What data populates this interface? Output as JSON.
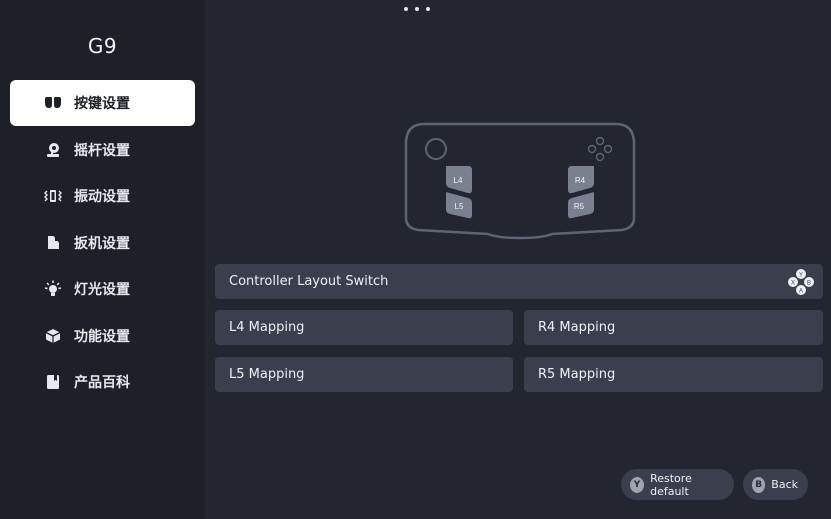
{
  "sidebar": {
    "brand": "G9",
    "items": [
      {
        "label": "按键设置",
        "icon": "buttons-icon",
        "active": true
      },
      {
        "label": "摇杆设置",
        "icon": "joystick-icon",
        "active": false
      },
      {
        "label": "振动设置",
        "icon": "vibration-icon",
        "active": false
      },
      {
        "label": "扳机设置",
        "icon": "trigger-icon",
        "active": false
      },
      {
        "label": "灯光设置",
        "icon": "light-icon",
        "active": false
      },
      {
        "label": "功能设置",
        "icon": "function-cube-icon",
        "active": false
      },
      {
        "label": "产品百科",
        "icon": "book-icon",
        "active": false
      }
    ]
  },
  "controller": {
    "l4": "L4",
    "l5": "L5",
    "r4": "R4",
    "r5": "R5"
  },
  "cards": {
    "layout_switch": "Controller Layout Switch",
    "l4_mapping": "L4 Mapping",
    "r4_mapping": "R4 Mapping",
    "l5_mapping": "L5 Mapping",
    "r5_mapping": "R5 Mapping"
  },
  "abxy": {
    "y": "Y",
    "x": "X",
    "b": "B",
    "a": "A"
  },
  "footer": {
    "restore_key": "Y",
    "restore_label": "Restore default",
    "back_key": "B",
    "back_label": "Back"
  },
  "colors": {
    "sidebar_bg": "#1e2027",
    "main_bg": "#23262f",
    "card_bg": "#3b3f4d",
    "active_bg": "#ffffff",
    "outline": "#5f6472",
    "paddle": "#7b8090"
  }
}
